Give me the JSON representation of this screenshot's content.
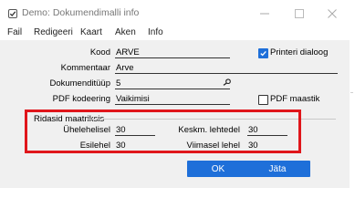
{
  "window": {
    "title": "Demo: Dokumendimalli info",
    "icons": {
      "app": "checkbox-app-icon",
      "minimize": "minimize-icon",
      "maximize": "maximize-icon",
      "close": "close-icon"
    }
  },
  "menu": {
    "file": "Fail",
    "edit": "Redigeeri",
    "map": "Kaart",
    "window": "Aken",
    "info": "Info"
  },
  "form": {
    "kood_label": "Kood",
    "kood_value": "ARVE",
    "kommentaar_label": "Kommentaar",
    "kommentaar_value": "Arve",
    "dokumenditüüp_label": "Dokumenditüüp",
    "dokumenditüüp_value": "5",
    "pdf_kodeering_label": "PDF kodeering",
    "pdf_kodeering_value": "Vaikimisi",
    "printeri_dialoog_label": "Printeri dialoog",
    "printeri_dialoog_checked": true,
    "pdf_maastik_label": "PDF maastik",
    "pdf_maastik_checked": false,
    "lookup_icon": "magnifier-icon"
  },
  "margins": {
    "group_title": "Ridasid maatriksis",
    "uhelehelisel_label": "Ühelehelisel",
    "uhelehelisel_value": "30",
    "keskm_lehtedel_label": "Keskm. lehtedel",
    "keskm_lehtedel_value": "30",
    "esilehel_label": "Esilehel",
    "esilehel_value": "30",
    "viimasel_lehel_label": "Viimasel lehel",
    "viimasel_lehel_value": "30",
    "highlight_color": "#e0161b"
  },
  "buttons": {
    "ok": "OK",
    "cancel": "Jäta"
  },
  "colors": {
    "accent": "#1e6fd9",
    "window_bg": "#f0f0f0"
  }
}
